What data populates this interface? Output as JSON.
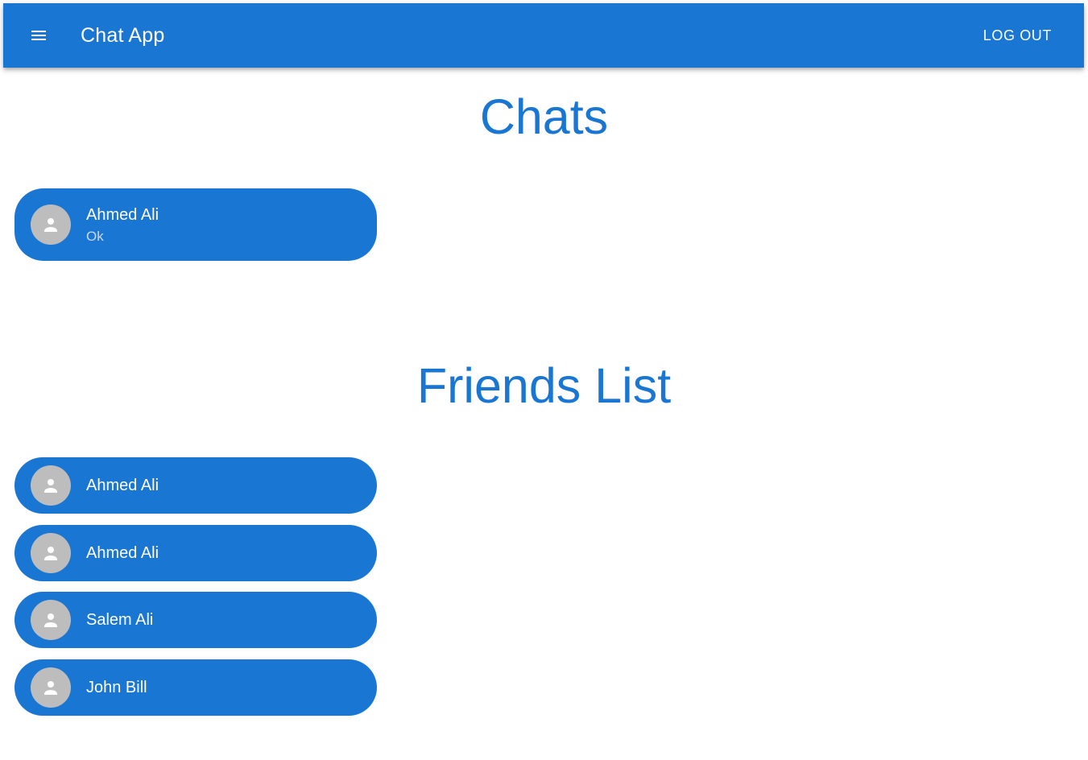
{
  "app_bar": {
    "menu_icon": "menu-icon",
    "title": "Chat App",
    "logout_label": "LOG OUT",
    "background": "#1976d2"
  },
  "chats": {
    "title": "Chats",
    "items": [
      {
        "name": "Ahmed Ali",
        "last_message": "Ok",
        "avatar_icon": "person-icon"
      }
    ]
  },
  "friends": {
    "title": "Friends List",
    "items": [
      {
        "name": "Ahmed Ali",
        "avatar_icon": "person-icon"
      },
      {
        "name": "Ahmed Ali",
        "avatar_icon": "person-icon"
      },
      {
        "name": "Salem Ali",
        "avatar_icon": "person-icon"
      },
      {
        "name": "John Bill",
        "avatar_icon": "person-icon"
      }
    ]
  },
  "colors": {
    "primary": "#1976d2",
    "avatar_bg": "#bdbdbd",
    "text_on_primary": "#ffffff"
  }
}
